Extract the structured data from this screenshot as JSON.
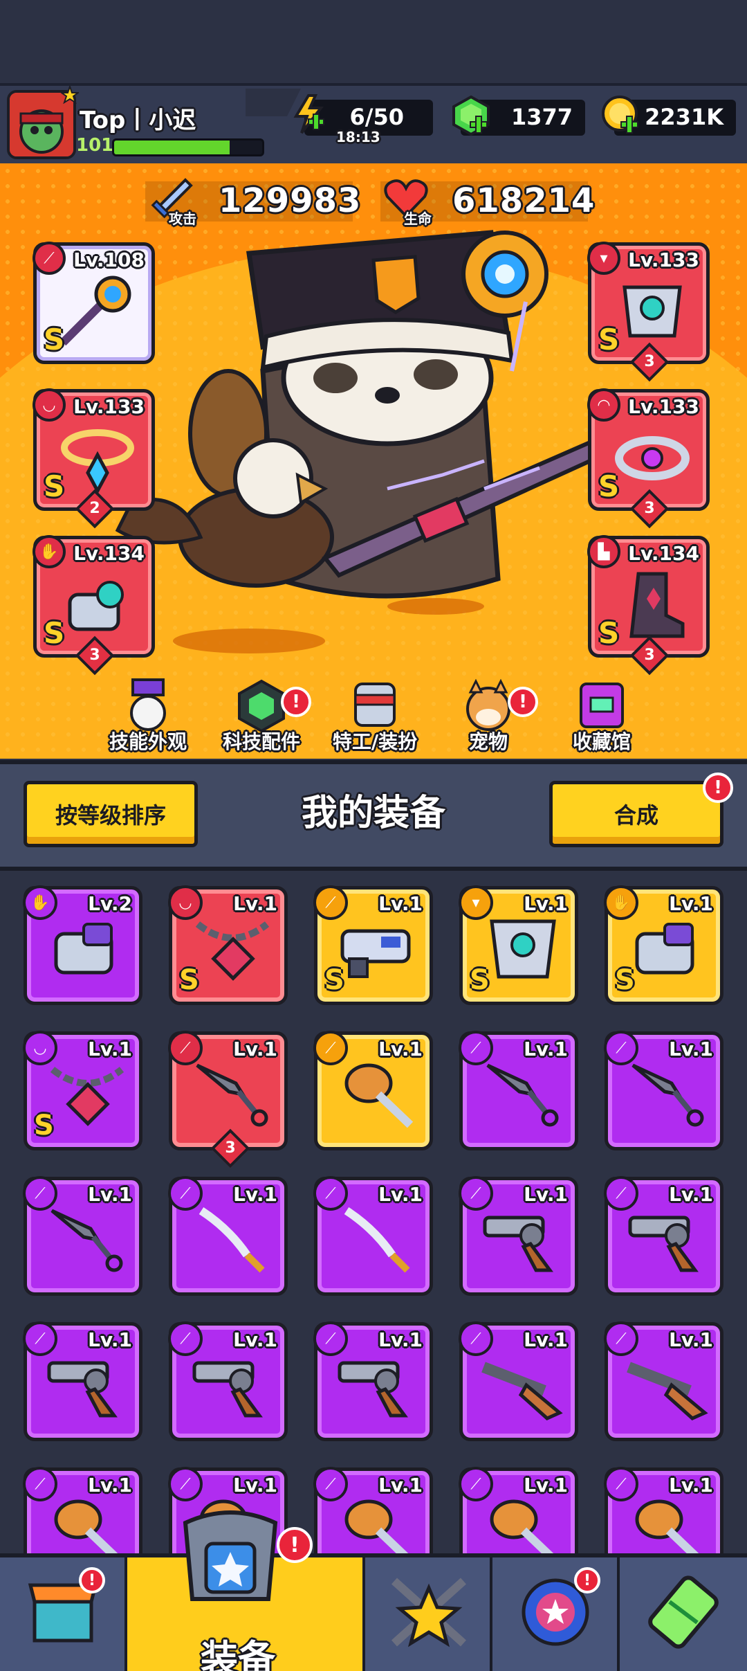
{
  "player": {
    "name": "Top丨小迟",
    "level": "101",
    "xp_fraction": 0.78
  },
  "resources": {
    "energy": {
      "value": "6/50",
      "timer": "18:13"
    },
    "gems": {
      "value": "1377"
    },
    "coins": {
      "value": "2231K"
    }
  },
  "stats": {
    "attack": {
      "label": "攻击",
      "value": "129983"
    },
    "hp": {
      "label": "生命",
      "value": "618214"
    }
  },
  "equipped": [
    {
      "slot": "weapon",
      "level": "Lv.108",
      "rank": "S",
      "stars": "",
      "icon": "staff-icon"
    },
    {
      "slot": "necklace",
      "level": "Lv.133",
      "rank": "S",
      "stars": "2",
      "icon": "necklace-icon"
    },
    {
      "slot": "gloves",
      "level": "Lv.134",
      "rank": "S",
      "stars": "3",
      "icon": "glove-icon"
    },
    {
      "slot": "armor",
      "level": "Lv.133",
      "rank": "S",
      "stars": "3",
      "icon": "armor-icon"
    },
    {
      "slot": "ring",
      "level": "Lv.133",
      "rank": "S",
      "stars": "3",
      "icon": "ring-icon"
    },
    {
      "slot": "boots",
      "level": "Lv.134",
      "rank": "S",
      "stars": "3",
      "icon": "boot-icon"
    }
  ],
  "menu": [
    {
      "label": "技能外观",
      "icon": "skill-skin-icon",
      "badge": false
    },
    {
      "label": "科技配件",
      "icon": "tech-part-icon",
      "badge": true
    },
    {
      "label": "特工/装扮",
      "icon": "agent-icon",
      "badge": false
    },
    {
      "label": "宠物",
      "icon": "pet-icon",
      "badge": true
    },
    {
      "label": "收藏馆",
      "icon": "collection-icon",
      "badge": false
    }
  ],
  "panel": {
    "title": "我的装备",
    "sort_label": "按等级排序",
    "merge_label": "合成",
    "merge_badge": "!"
  },
  "inventory": [
    {
      "level": "Lv.2",
      "rarity": "purple",
      "rank": "",
      "stars": "",
      "icon": "glove-icon",
      "type": "glove"
    },
    {
      "level": "Lv.1",
      "rarity": "red",
      "rank": "S",
      "stars": "",
      "icon": "chain-necklace-icon",
      "type": "necklace"
    },
    {
      "level": "Lv.1",
      "rarity": "gold",
      "rank": "S",
      "stars": "",
      "icon": "blaster-icon",
      "type": "weapon"
    },
    {
      "level": "Lv.1",
      "rarity": "gold",
      "rank": "S",
      "stars": "",
      "icon": "armor-icon",
      "type": "armor"
    },
    {
      "level": "Lv.1",
      "rarity": "gold",
      "rank": "S",
      "stars": "",
      "icon": "glove-icon",
      "type": "glove"
    },
    {
      "level": "Lv.1",
      "rarity": "purple",
      "rank": "S",
      "stars": "",
      "icon": "chain-necklace-icon",
      "type": "necklace"
    },
    {
      "level": "Lv.1",
      "rarity": "red",
      "rank": "",
      "stars": "3",
      "icon": "kunai-icon",
      "type": "weapon"
    },
    {
      "level": "Lv.1",
      "rarity": "gold",
      "rank": "",
      "stars": "",
      "icon": "torch-icon",
      "type": "weapon"
    },
    {
      "level": "Lv.1",
      "rarity": "purple",
      "rank": "",
      "stars": "",
      "icon": "kunai-icon",
      "type": "weapon"
    },
    {
      "level": "Lv.1",
      "rarity": "purple",
      "rank": "",
      "stars": "",
      "icon": "kunai-icon",
      "type": "weapon"
    },
    {
      "level": "Lv.1",
      "rarity": "purple",
      "rank": "",
      "stars": "",
      "icon": "kunai-icon",
      "type": "weapon"
    },
    {
      "level": "Lv.1",
      "rarity": "purple",
      "rank": "",
      "stars": "",
      "icon": "katana-icon",
      "type": "weapon"
    },
    {
      "level": "Lv.1",
      "rarity": "purple",
      "rank": "",
      "stars": "",
      "icon": "katana-icon",
      "type": "weapon"
    },
    {
      "level": "Lv.1",
      "rarity": "purple",
      "rank": "",
      "stars": "",
      "icon": "revolver-icon",
      "type": "weapon"
    },
    {
      "level": "Lv.1",
      "rarity": "purple",
      "rank": "",
      "stars": "",
      "icon": "revolver-icon",
      "type": "weapon"
    },
    {
      "level": "Lv.1",
      "rarity": "purple",
      "rank": "",
      "stars": "",
      "icon": "revolver-icon",
      "type": "weapon"
    },
    {
      "level": "Lv.1",
      "rarity": "purple",
      "rank": "",
      "stars": "",
      "icon": "revolver-icon",
      "type": "weapon"
    },
    {
      "level": "Lv.1",
      "rarity": "purple",
      "rank": "",
      "stars": "",
      "icon": "revolver-icon",
      "type": "weapon"
    },
    {
      "level": "Lv.1",
      "rarity": "purple",
      "rank": "",
      "stars": "",
      "icon": "shotgun-icon",
      "type": "weapon"
    },
    {
      "level": "Lv.1",
      "rarity": "purple",
      "rank": "",
      "stars": "",
      "icon": "shotgun-icon",
      "type": "weapon"
    },
    {
      "level": "Lv.1",
      "rarity": "purple",
      "rank": "",
      "stars": "",
      "icon": "torch-icon",
      "type": "weapon"
    },
    {
      "level": "Lv.1",
      "rarity": "purple",
      "rank": "",
      "stars": "",
      "icon": "torch-icon",
      "type": "weapon"
    },
    {
      "level": "Lv.1",
      "rarity": "purple",
      "rank": "",
      "stars": "",
      "icon": "torch-icon",
      "type": "weapon"
    },
    {
      "level": "Lv.1",
      "rarity": "purple",
      "rank": "",
      "stars": "",
      "icon": "torch-icon",
      "type": "weapon"
    },
    {
      "level": "Lv.1",
      "rarity": "purple",
      "rank": "",
      "stars": "",
      "icon": "torch-icon",
      "type": "weapon"
    }
  ],
  "bottom_nav": [
    {
      "name": "shop",
      "icon": "shop-icon",
      "label": "",
      "badge": true
    },
    {
      "name": "equipment",
      "icon": "equipment-icon",
      "label": "装备",
      "badge": true,
      "active": true
    },
    {
      "name": "battle",
      "icon": "battle-icon",
      "label": "",
      "badge": false
    },
    {
      "name": "talent",
      "icon": "talent-orb-icon",
      "label": "",
      "badge": true
    },
    {
      "name": "evolution",
      "icon": "evolution-icon",
      "label": "",
      "badge": false
    }
  ],
  "colors": {
    "purple": "#b02cf0",
    "red": "#ec4353",
    "gold": "#ffc41f",
    "accent_yellow": "#ffd21f",
    "stage_orange": "#ff8f0c"
  }
}
